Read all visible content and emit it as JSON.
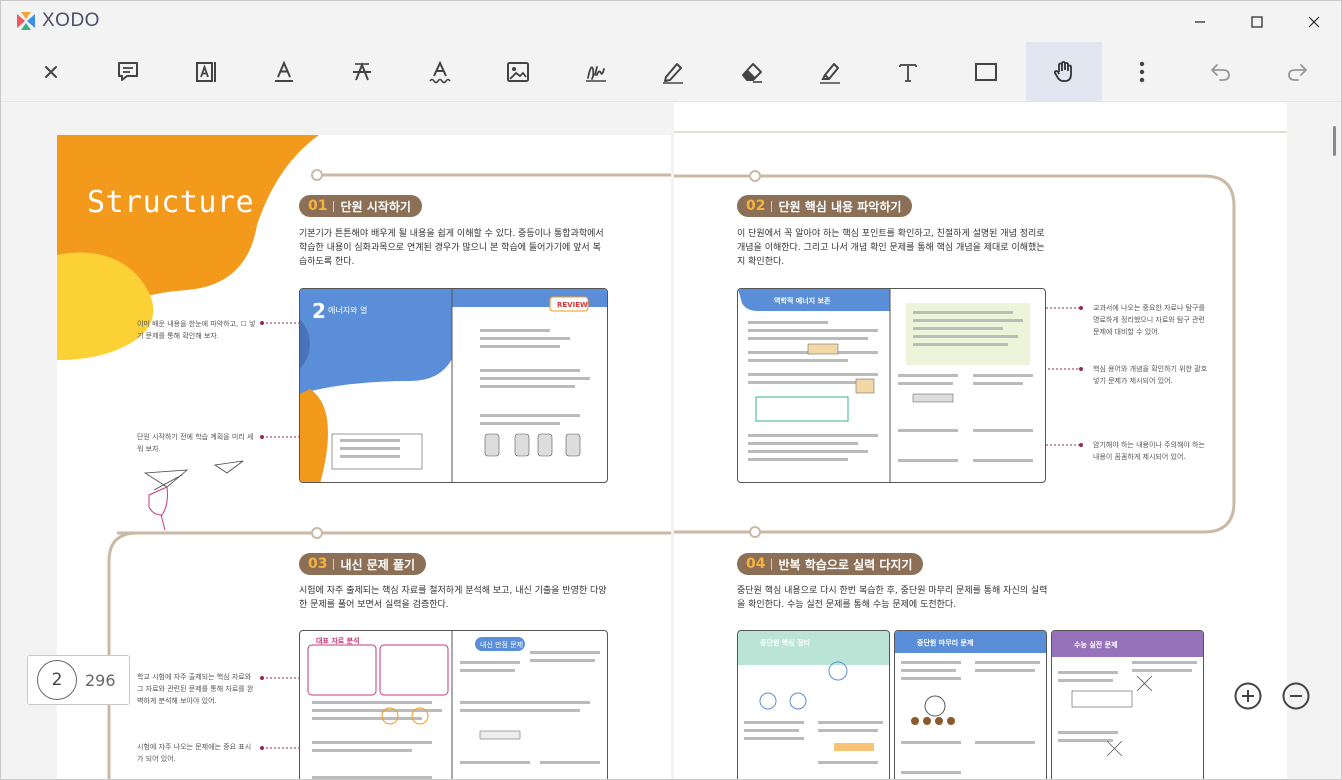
{
  "app": {
    "name": "XODO"
  },
  "window_controls": {
    "minimize": "minimize",
    "maximize": "maximize",
    "close": "close"
  },
  "toolbar": {
    "tools": [
      {
        "id": "close",
        "icon": "close-icon"
      },
      {
        "id": "comment",
        "icon": "comment-icon"
      },
      {
        "id": "free-text",
        "icon": "free-text-icon"
      },
      {
        "id": "underline",
        "icon": "underline-icon"
      },
      {
        "id": "strikeout",
        "icon": "strikeout-icon"
      },
      {
        "id": "squiggly",
        "icon": "squiggly-icon"
      },
      {
        "id": "image",
        "icon": "image-icon"
      },
      {
        "id": "signature",
        "icon": "signature-icon"
      },
      {
        "id": "pen",
        "icon": "pen-icon"
      },
      {
        "id": "eraser",
        "icon": "eraser-icon"
      },
      {
        "id": "highlighter",
        "icon": "highlighter-icon"
      },
      {
        "id": "text",
        "icon": "text-icon"
      },
      {
        "id": "rectangle",
        "icon": "rectangle-icon"
      },
      {
        "id": "pan",
        "icon": "hand-icon",
        "active": true
      },
      {
        "id": "more",
        "icon": "more-vertical-icon"
      },
      {
        "id": "undo",
        "icon": "undo-icon"
      },
      {
        "id": "redo",
        "icon": "redo-icon"
      }
    ]
  },
  "document": {
    "cover_title": "Structure",
    "sections": [
      {
        "num": "01",
        "title": "단원 시작하기",
        "desc": "기본기가 튼튼해야 배우게 될 내용을 쉽게 이해할 수 있다. 중등이나 통합과학에서 학습한 내용이 심화과목으로 연계된 경우가 많으니 본 학습에 들어가기에 앞서 복습하도록 한다."
      },
      {
        "num": "02",
        "title": "단원 핵심 내용 파악하기",
        "desc": "이 단원에서 꼭 알아야 하는 핵심 포인트를 확인하고, 친절하게 설명된 개념 정리로 개념을 이해한다. 그리고 나서 개념 확인 문제를 통해 핵심 개념을 제대로 이해했는지 확인한다."
      },
      {
        "num": "03",
        "title": "내신 문제 풀기",
        "desc": "시험에 자주 출제되는 핵심 자료를 철저하게 분석해 보고, 내신 기출을 반영한 다양한 문제를 풀어 보면서 실력을 검증한다."
      },
      {
        "num": "04",
        "title": "반복 학습으로 실력 다지기",
        "desc": "중단원 핵심 내용으로 다시 한번 복습한 후, 중단원 마무리 문제를 통해 자신의 실력을 확인한다. 수능 실전 문제를 통해 수능 문제에 도전한다."
      }
    ],
    "notes_left": [
      "이미 배운 내용을 한눈에 파악하고, ☐ 넣기 문제를 통해 확인해 보자.",
      "단원 시작하기 전에 학습 계획을 미리 세워 보자.",
      "학교 시험에 자주 출제되는 핵심 자료와 그 자료와 관련된 문제를 통해 자료를 완벽하게 분석해 보아야 있어.",
      "시험에 자주 나오는 문제에는 중요 표시가 되어 있어."
    ],
    "notes_right": [
      "교과서에 나오는 중요한 자료나 탐구를 명료하게 정리했으니 자료와 탐구 관련 문제에 대비할 수 있어.",
      "핵심 용어와 개념을 확인하기 위한 괄호 넣기 문제가 제시되어 있어.",
      "암기해야 하는 내용이나 주의해야 하는 내용이 꼼꼼하게 제시되어 있어."
    ],
    "thumb_labels": {
      "review": "REVIEW",
      "chapter": "에너지와 열",
      "chapter_num": "2",
      "core": "역학적 에너지 보존",
      "data": "대표 자료 분석",
      "basic": "내신 만점 문제",
      "mid": "중단원 핵심 정리",
      "mid_quiz": "중단원 마무리 문제",
      "csat": "수능 실전 문제"
    }
  },
  "page_counter": {
    "current": "2",
    "total": "296"
  },
  "zoom": {
    "in": "zoom-in",
    "out": "zoom-out"
  },
  "colors": {
    "orange": "#f39a1c",
    "yellow": "#fbd135",
    "brown": "#8b7057",
    "accent_blue": "#5b8ed8"
  }
}
